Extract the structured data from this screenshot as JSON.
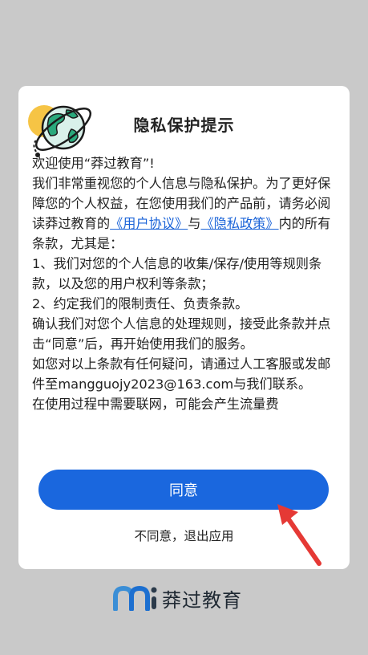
{
  "dialog": {
    "title": "隐私保护提示",
    "paragraphs": [
      "欢迎使用“莽过教育”!",
      "我们非常重视您的个人信息与隐私保护。为了更好保障您的个人权益，在您使用我们的产品前，请务必阅读莽过教育的",
      "《用户协议》",
      "与",
      "《隐私政策》",
      "内的所有条款，尤其是：",
      "1、我们对您的个人信息的收集/保存/使用等规则条款，以及您的用户权利等条款；",
      "2、约定我们的限制责任、负责条款。",
      "确认我们对您个人信息的处理规则，接受此条款并点击“同意”后，再开始使用我们的服务。",
      "如您对以上条款有任何疑问，请通过人工客服或发邮件至mangguojy2023@163.com与我们联系。",
      "在使用过程中需要联网，可能会产生流量费"
    ],
    "agree_label": "同意",
    "disagree_label": "不同意，退出应用"
  },
  "brand": {
    "name": "莽过教育"
  },
  "colors": {
    "accent": "#1a67de",
    "link": "#1a63d8",
    "arrow": "#e53935",
    "backdrop": "#c9c9c9"
  },
  "icons": [
    "globe-icon",
    "arrow-icon",
    "brand-logo-icon"
  ]
}
